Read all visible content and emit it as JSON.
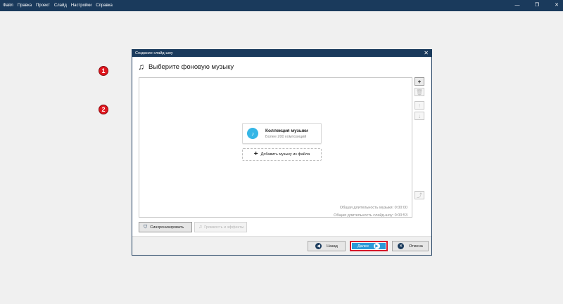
{
  "menubar": {
    "items": [
      "Файл",
      "Правка",
      "Проект",
      "Слайд",
      "Настройки",
      "Справка"
    ]
  },
  "window_controls": {
    "minimize": "—",
    "restore": "❐",
    "close": "✕"
  },
  "dialog": {
    "title": "Создание слайд-шоу",
    "close": "✕",
    "heading": "Выберите фоновую музыку",
    "collection": {
      "title": "Коллекция музыки",
      "subtitle": "Более 200 композиций"
    },
    "add_from_file": "Добавить музыку из файла",
    "badges": [
      "1",
      "2"
    ],
    "music_duration": "Общая длительность музыки: 0:00:00",
    "slideshow_duration": "Общая длительность слайд-шоу: 0:00:53",
    "tools": [
      "+",
      "🗑",
      "↑",
      "↓",
      "⤴"
    ],
    "sync_label": "Синхронизировать",
    "volume_label": "Громкость и эффекты",
    "buttons": {
      "back": "Назад",
      "next": "Далее",
      "cancel": "Отмена"
    }
  }
}
